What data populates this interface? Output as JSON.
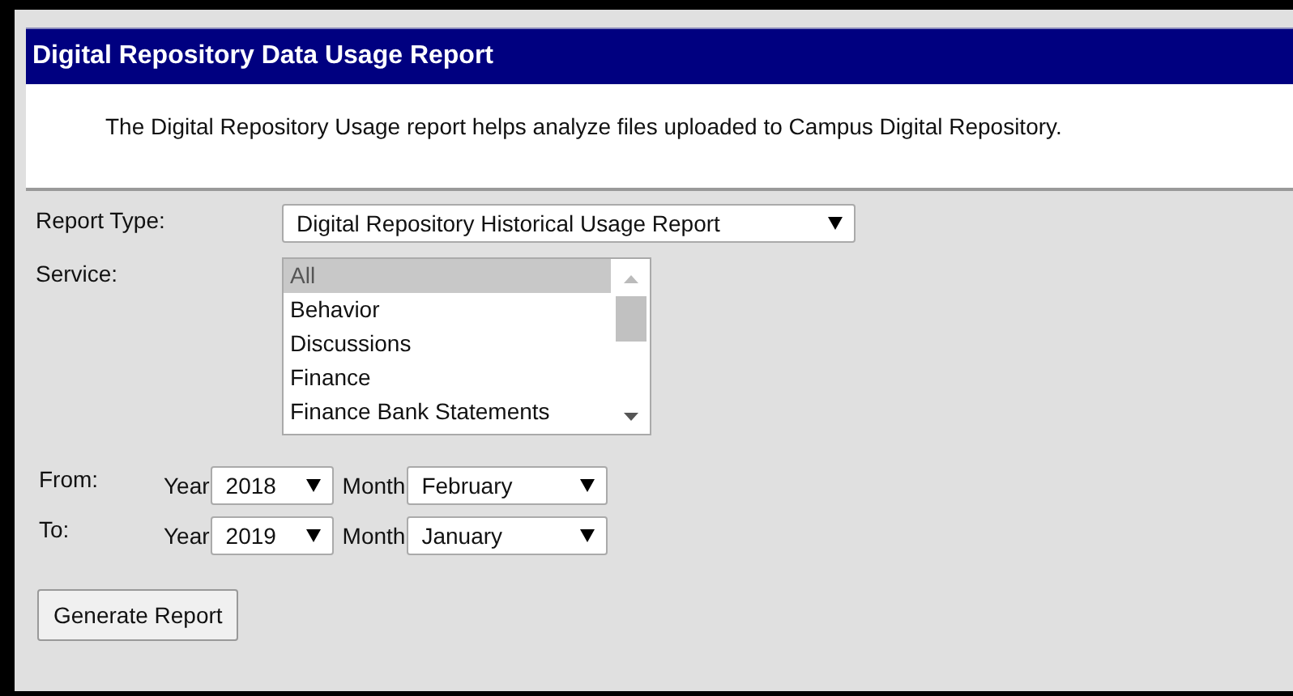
{
  "title": "Digital Repository Data Usage Report",
  "description": "The Digital Repository Usage report helps analyze files uploaded to Campus Digital Repository.",
  "report_type": {
    "label": "Report Type:",
    "value": "Digital Repository Historical Usage Report"
  },
  "service": {
    "label": "Service:",
    "items": [
      {
        "label": "All",
        "selected": true
      },
      {
        "label": "Behavior",
        "selected": false
      },
      {
        "label": "Discussions",
        "selected": false
      },
      {
        "label": "Finance",
        "selected": false
      },
      {
        "label": "Finance Bank Statements",
        "selected": false
      }
    ]
  },
  "date_rows": [
    {
      "label": "From:",
      "year_label": "Year",
      "year": "2018",
      "month_label": "Month",
      "month": "February"
    },
    {
      "label": "To:",
      "year_label": "Year",
      "year": "2019",
      "month_label": "Month",
      "month": "January"
    }
  ],
  "button": "Generate Report"
}
